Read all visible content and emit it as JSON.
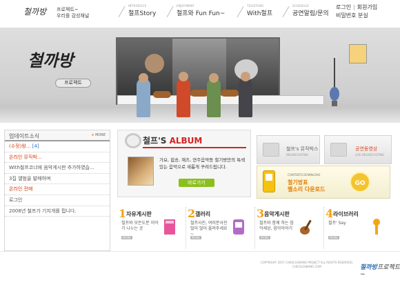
{
  "header": {
    "logo_text": "철까방",
    "tagline_line1": "프로젝트~",
    "tagline_line2": "우리를 감성채널",
    "nav": [
      {
        "sub": "INTRODUCE",
        "label": "철프Story"
      },
      {
        "sub": "ENJOYMENT",
        "label": "철프와 Fun Fun~"
      },
      {
        "sub": "TOGETHER",
        "label": "With철프"
      },
      {
        "sub": "SCHEDULE",
        "label": "공연알림/문의"
      }
    ],
    "account": {
      "login": "로그인",
      "signup": "회원가입",
      "lost_password": "비밀번호 분실"
    }
  },
  "hero": {
    "logo_text": "철까방",
    "badge": "프로젝트"
  },
  "updates": {
    "title": "업데이트소식",
    "more_label": "MORE",
    "items": [
      {
        "text": "(수정)왕...",
        "count": "[4]",
        "hot": true
      },
      {
        "text": "온라인 뮤직박...",
        "count": "",
        "hot": true
      },
      {
        "text": "With철프코너에 음악게시판 추가하였습...",
        "count": "",
        "hot": false
      },
      {
        "text": "3집 앨범을 발매하며",
        "count": "",
        "hot": false
      },
      {
        "text": "온라인 전매",
        "count": "",
        "hot": true
      },
      {
        "text": "로그인",
        "count": "",
        "hot": false
      },
      {
        "text": "2008년 철프가 기지개를 펍니다.",
        "count": "",
        "hot": false
      }
    ]
  },
  "album": {
    "title_prefix": "철프'S",
    "title_accent": "ALBUM",
    "desc": "가요, 힙송, 재즈, 연주음악등 철기방만의 특색있는 음악으로 새롭게 꾸려드립니다.",
    "button": "바로가기"
  },
  "boxes": {
    "music_box": {
      "title": "철프's 뮤직박스",
      "sub": "BROADCASTING"
    },
    "live": {
      "title": "공연동영상",
      "sub": "LIVE BROADCASTING"
    }
  },
  "download": {
    "small": "CONTENTS DOWNLOAD",
    "line1": "철기방표",
    "line2": "벨소리 다운로드",
    "go": "GO"
  },
  "boards": [
    {
      "num": "1",
      "title": "자유게시판",
      "desc": "철프와 모든도분 이야기 나누는 곳",
      "more": "MORE"
    },
    {
      "num": "2",
      "title": "갤러리",
      "desc": "철프사진, 여러분사진 많이 많이 올려주세요~",
      "more": "MORE"
    },
    {
      "num": "3",
      "title": "음악게시판",
      "desc": "철프와 함께 하는 음악세상, 음악이야기",
      "more": "MORE"
    },
    {
      "num": "4",
      "title": "라이브러리",
      "desc": "철프' Say",
      "more": "MORE"
    }
  ],
  "footer": {
    "copyright_line1": "COPYRIGHT 2007 CHEOLGABANG PROJECT ALL RIGHTS RESERVED.",
    "copyright_line2": "CHEOLGABANG.COM",
    "logo_text": "철까방",
    "logo_suffix": "프로젝트~"
  },
  "colors": {
    "accent_orange": "#f2a013",
    "album_red": "#d42323",
    "button_green": "#8bbf1e"
  }
}
